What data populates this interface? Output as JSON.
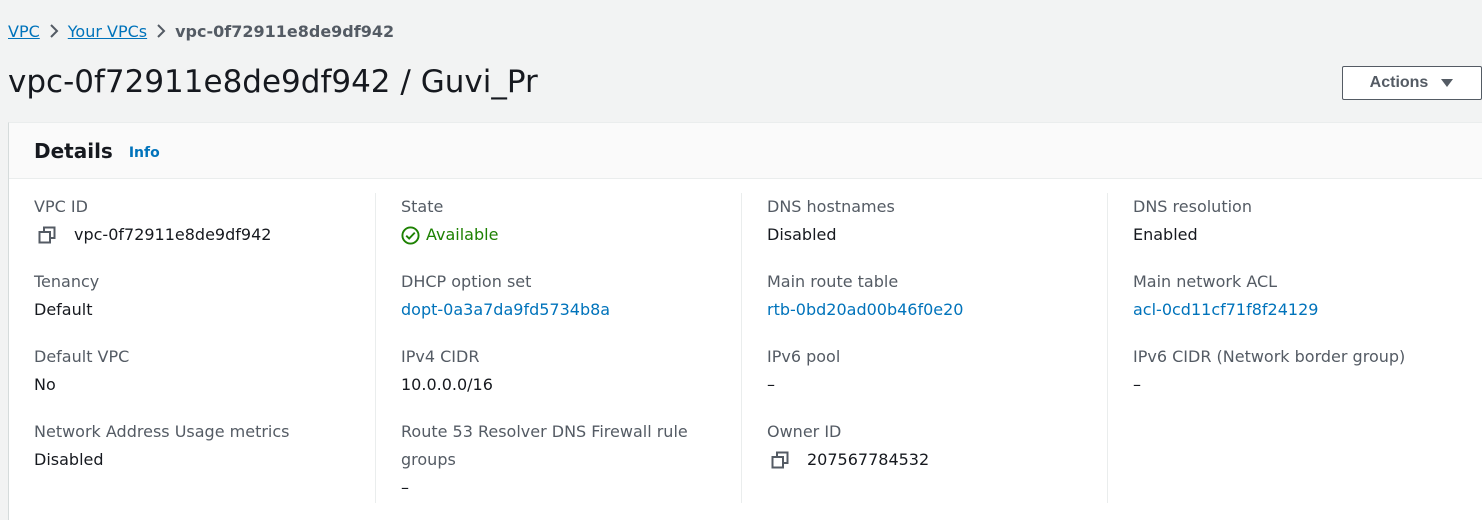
{
  "breadcrumb": {
    "items": [
      "VPC",
      "Your VPCs"
    ],
    "current": "vpc-0f72911e8de9df942"
  },
  "page": {
    "title": "vpc-0f72911e8de9df942 / Guvi_Pr",
    "actions_label": "Actions"
  },
  "details": {
    "heading": "Details",
    "info_label": "Info",
    "columns": [
      {
        "fields": [
          {
            "label": "VPC ID",
            "value": "vpc-0f72911e8de9df942",
            "copy": true
          },
          {
            "label": "Tenancy",
            "value": "Default"
          },
          {
            "label": "Default VPC",
            "value": "No"
          },
          {
            "label": "Network Address Usage metrics",
            "value": "Disabled"
          }
        ]
      },
      {
        "fields": [
          {
            "label": "State",
            "value": "Available",
            "status": "success"
          },
          {
            "label": "DHCP option set",
            "value": "dopt-0a3a7da9fd5734b8a",
            "link": true
          },
          {
            "label": "IPv4 CIDR",
            "value": "10.0.0.0/16"
          },
          {
            "label_line1": "Route 53 Resolver DNS Firewall rule",
            "label_line2": "groups",
            "value": "–"
          }
        ]
      },
      {
        "fields": [
          {
            "label": "DNS hostnames",
            "value": "Disabled"
          },
          {
            "label": "Main route table",
            "value": "rtb-0bd20ad00b46f0e20",
            "link": true
          },
          {
            "label": "IPv6 pool",
            "value": "–"
          },
          {
            "label": "Owner ID",
            "value": "207567784532",
            "copy": true
          }
        ]
      },
      {
        "fields": [
          {
            "label": "DNS resolution",
            "value": "Enabled"
          },
          {
            "label": "Main network ACL",
            "value": "acl-0cd11cf71f8f24129",
            "link": true
          },
          {
            "label": "IPv6 CIDR (Network border group)",
            "value": "–"
          }
        ]
      }
    ]
  },
  "colors": {
    "link": "#0073bb",
    "success": "#1d8102",
    "text": "#16191f",
    "label": "#545b64"
  }
}
